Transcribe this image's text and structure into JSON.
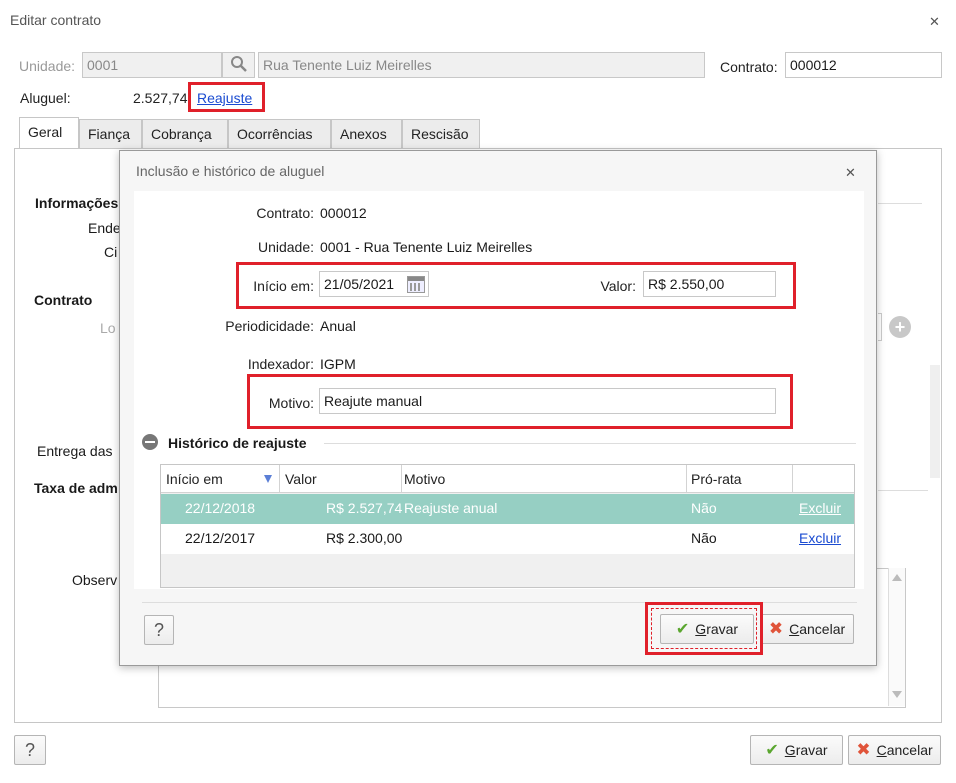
{
  "window": {
    "title": "Editar contrato",
    "close": "✕"
  },
  "header": {
    "unidade_label": "Unidade:",
    "unidade_code": "0001",
    "unidade_address": "Rua Tenente Luiz Meirelles",
    "contrato_label": "Contrato:",
    "contrato_value": "000012",
    "aluguel_label": "Aluguel:",
    "aluguel_value": "2.527,74",
    "reajuste_link": "Reajuste"
  },
  "tabs": [
    "Geral",
    "Fiança",
    "Cobrança",
    "Ocorrências",
    "Anexos",
    "Rescisão"
  ],
  "background_labels": {
    "informacoes": "Informações",
    "ende": "Ende",
    "ci": "Ci",
    "contrato": "Contrato",
    "lo": "Lo",
    "entrega": "Entrega das",
    "taxa": "Taxa de adm",
    "observ": "Observ"
  },
  "dialog": {
    "title": "Inclusão e histórico de aluguel",
    "close": "✕",
    "contrato_label": "Contrato:",
    "contrato_value": "000012",
    "unidade_label": "Unidade:",
    "unidade_value": "0001 - Rua Tenente Luiz Meirelles",
    "inicio_label": "Início em:",
    "inicio_value": "21/05/2021",
    "valor_label": "Valor:",
    "valor_value": "R$ 2.550,00",
    "periodicidade_label": "Periodicidade:",
    "periodicidade_value": "Anual",
    "indexador_label": "Indexador:",
    "indexador_value": "IGPM",
    "motivo_label": "Motivo:",
    "motivo_value": "Reajute manual",
    "historico_title": "Histórico de reajuste",
    "columns": [
      "Início em",
      "Valor",
      "Motivo",
      "Pró-rata",
      ""
    ],
    "rows": [
      {
        "inicio": "22/12/2018",
        "valor": "R$ 2.527,74",
        "motivo": "Reajuste anual",
        "prorata": "Não",
        "action": "Excluir",
        "selected": true
      },
      {
        "inicio": "22/12/2017",
        "valor": "R$ 2.300,00",
        "motivo": "",
        "prorata": "Não",
        "action": "Excluir",
        "selected": false
      }
    ],
    "help": "?",
    "gravar_prefix": "",
    "gravar_u": "G",
    "gravar_rest": "ravar",
    "cancelar_u": "C",
    "cancelar_rest": "ancelar"
  },
  "footer": {
    "help": "?",
    "gravar_u": "G",
    "gravar_rest": "ravar",
    "cancelar_u": "C",
    "cancelar_rest": "ancelar"
  },
  "colors": {
    "selected_row": "#96cfc3",
    "highlight": "#e0202a",
    "link": "#1a4bd1"
  }
}
